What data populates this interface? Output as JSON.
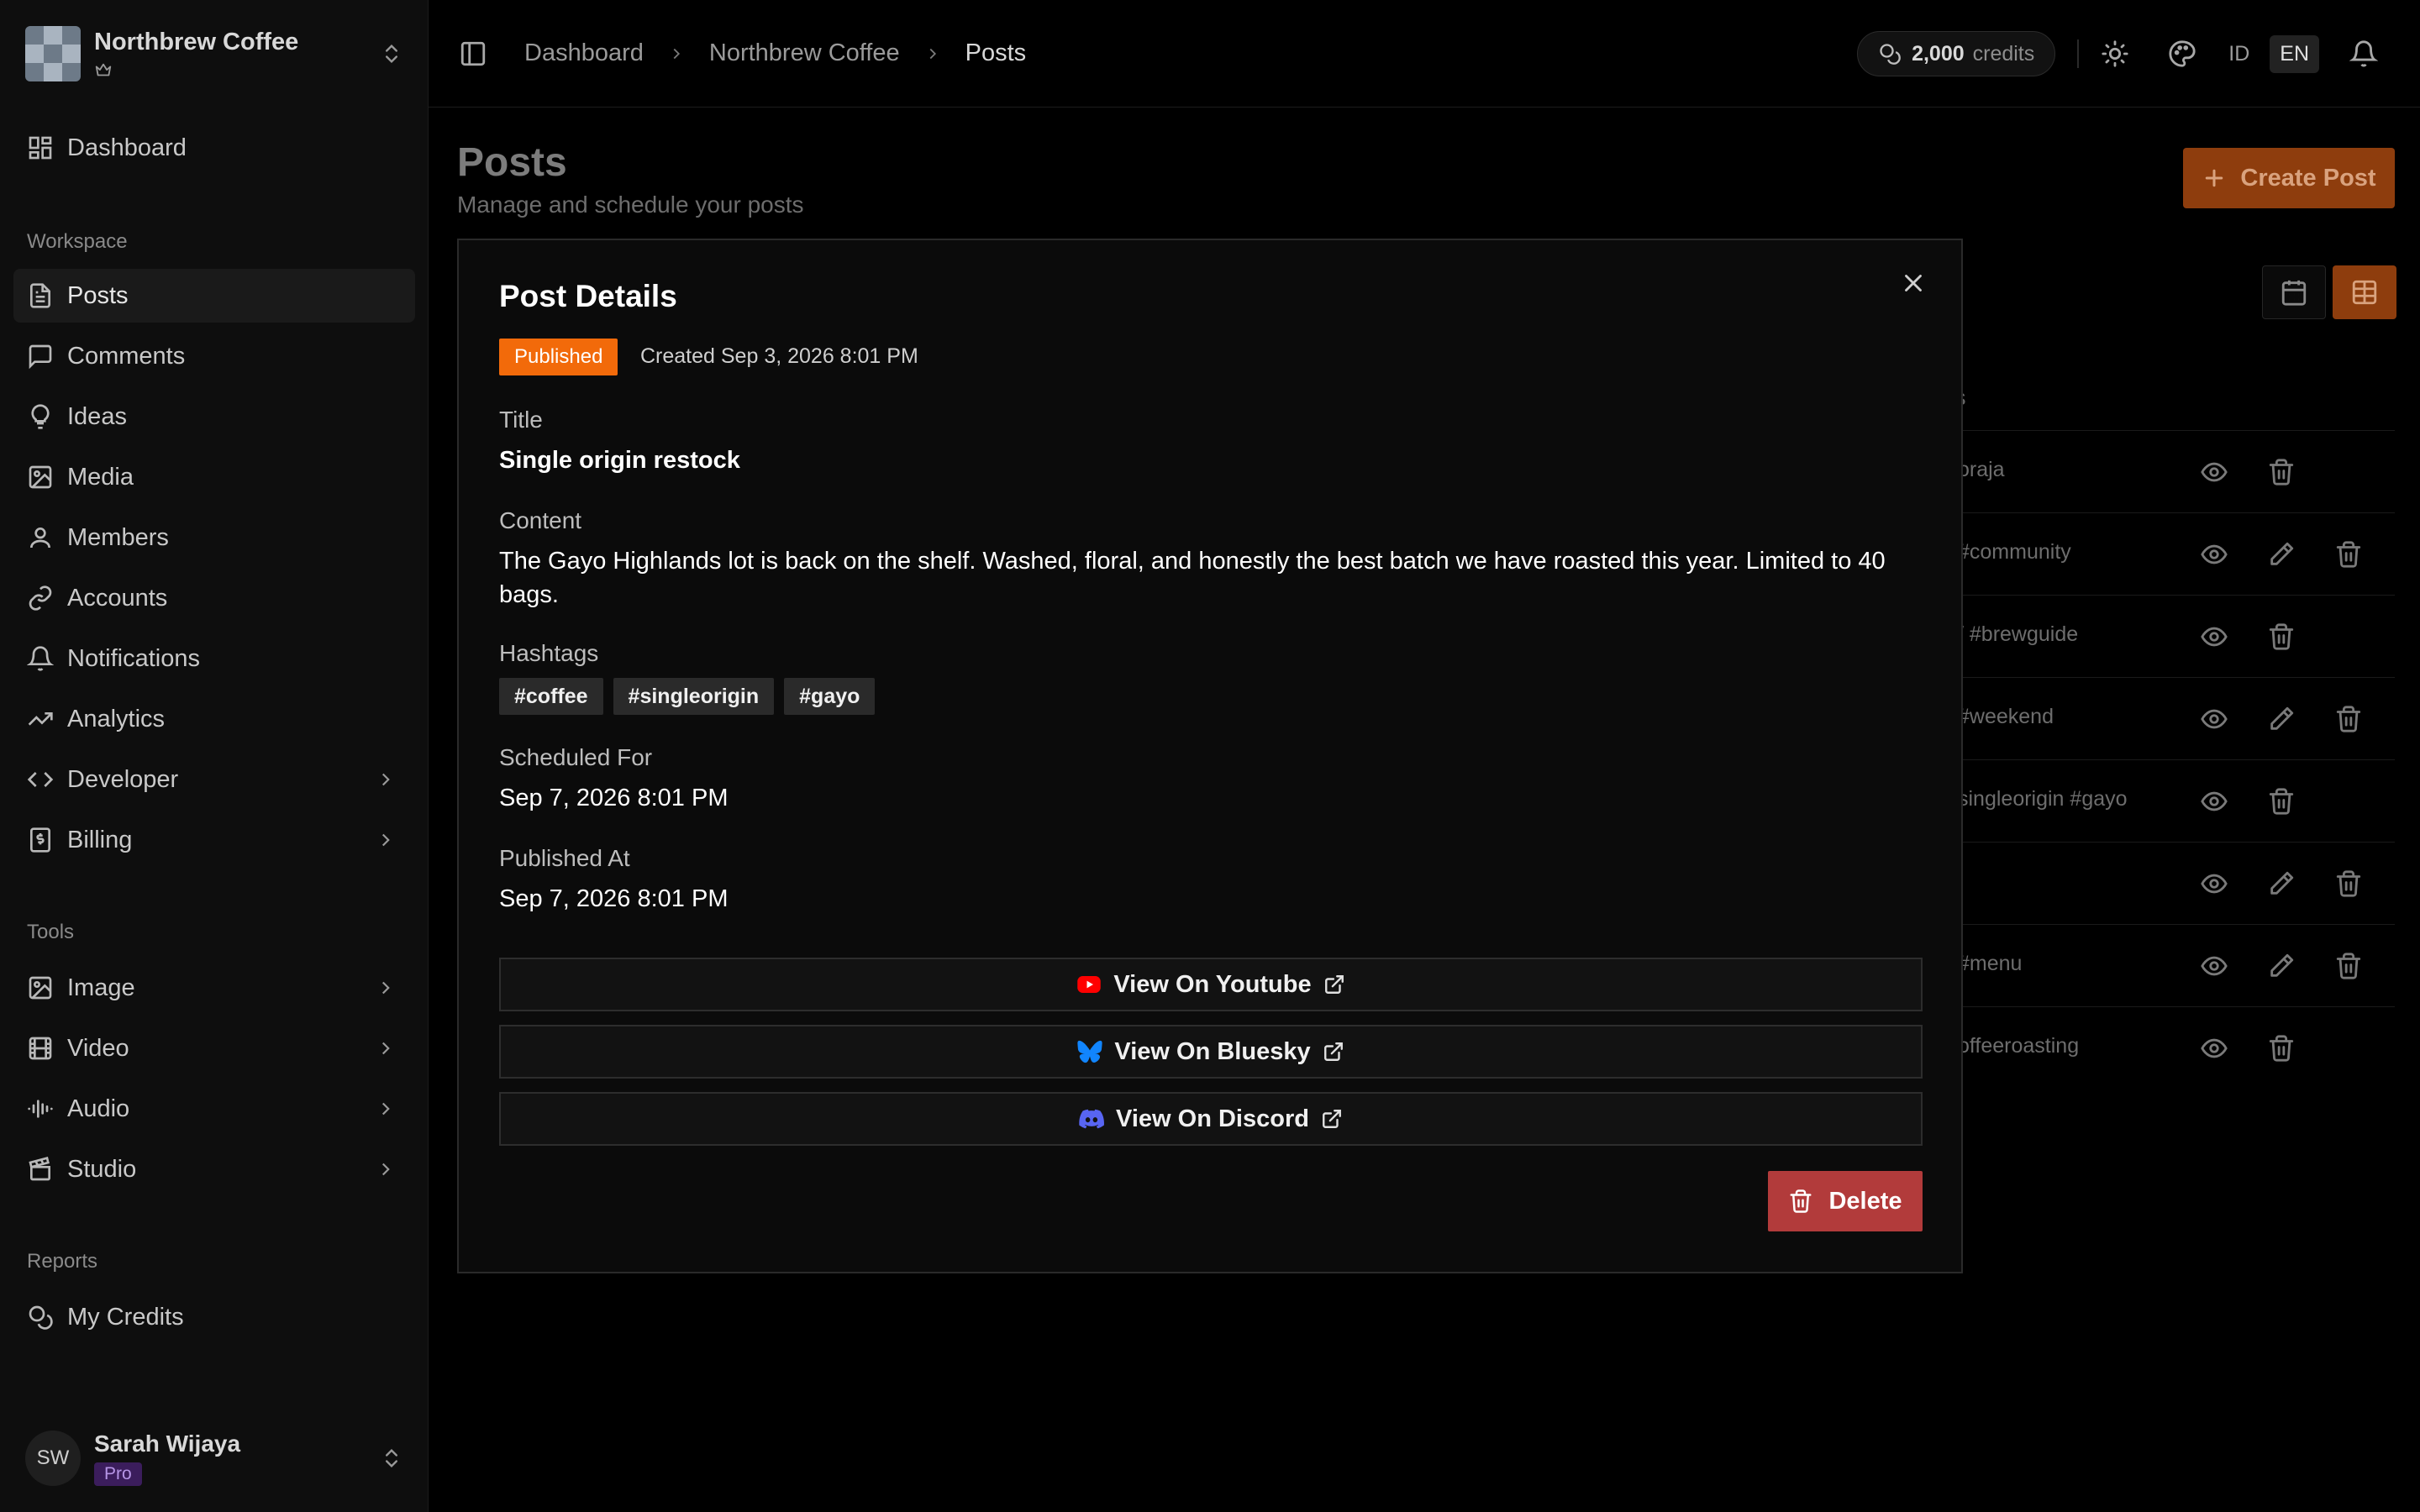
{
  "org": {
    "name": "Northbrew Coffee"
  },
  "sidebar": {
    "top_item": {
      "label": "Dashboard"
    },
    "sections": {
      "workspace": "Workspace",
      "tools": "Tools",
      "reports": "Reports"
    },
    "workspace_items": [
      "Posts",
      "Comments",
      "Ideas",
      "Media",
      "Members",
      "Accounts",
      "Notifications",
      "Analytics",
      "Developer",
      "Billing"
    ],
    "tools_items": [
      "Image",
      "Video",
      "Audio",
      "Studio"
    ],
    "reports_items": [
      "My Credits"
    ]
  },
  "user": {
    "initials": "SW",
    "name": "Sarah Wijaya",
    "plan": "Pro"
  },
  "header": {
    "breadcrumb": [
      "Dashboard",
      "Northbrew Coffee",
      "Posts"
    ],
    "credits_amount": "2,000",
    "credits_unit": "credits",
    "lang_id": "ID",
    "lang_en": "EN"
  },
  "page": {
    "title": "Posts",
    "subtitle": "Manage and schedule your posts",
    "create_label": "Create Post",
    "table_header_fragment": "s"
  },
  "table_rows": [
    {
      "tags": "oraja",
      "edit": false
    },
    {
      "tags": "#community",
      "edit": true
    },
    {
      "tags": "/ #brewguide",
      "edit": false
    },
    {
      "tags": "#weekend",
      "edit": true
    },
    {
      "tags": "singleorigin #gayo",
      "edit": false
    },
    {
      "tags": "",
      "edit": true
    },
    {
      "tags": " #menu",
      "edit": true
    },
    {
      "tags": "offeeroasting",
      "edit": false
    }
  ],
  "modal": {
    "title": "Post Details",
    "status": "Published",
    "created": "Created Sep 3, 2026 8:01 PM",
    "title_label": "Title",
    "title_value": "Single origin restock",
    "content_label": "Content",
    "content_value": "The Gayo Highlands lot is back on the shelf. Washed, floral, and honestly the best batch we have roasted this year. Limited to 40 bags.",
    "hashtags_label": "Hashtags",
    "hashtags": [
      "#coffee",
      "#singleorigin",
      "#gayo"
    ],
    "scheduled_label": "Scheduled For",
    "scheduled_value": "Sep 7, 2026 8:01 PM",
    "published_label": "Published At",
    "published_value": "Sep 7, 2026 8:01 PM",
    "links": {
      "youtube": "View On Youtube",
      "bluesky": "View On Bluesky",
      "discord": "View On Discord"
    },
    "delete_label": "Delete"
  },
  "colors": {
    "accent": "#f26a0a",
    "danger": "#b23b3b",
    "youtube": "#ff0000",
    "bluesky": "#1185fe",
    "discord": "#5865f2"
  }
}
